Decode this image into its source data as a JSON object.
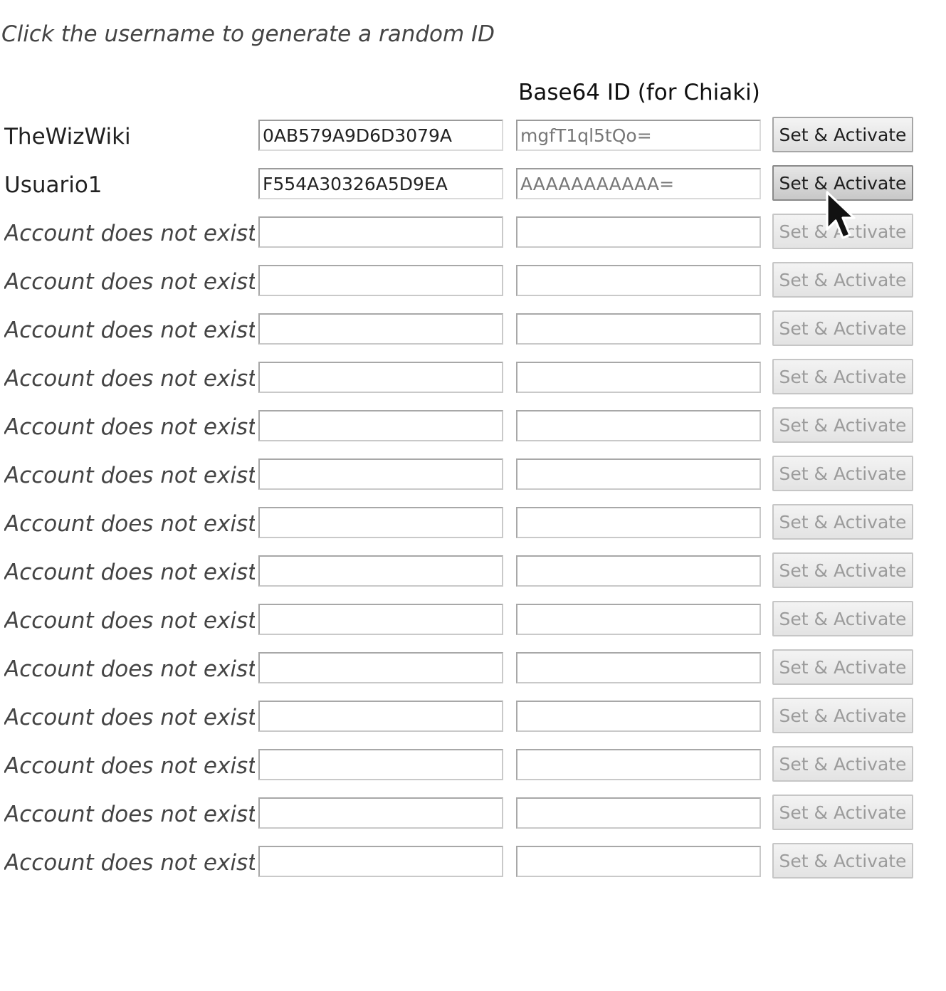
{
  "hint": "Click the username to generate a random ID",
  "header": {
    "base64_column": "Base64 ID (for Chiaki)"
  },
  "accounts": [
    {
      "username": "TheWizWiki",
      "hex_id": "0AB579A9D6D3079A",
      "base64_id": "mgfT1ql5tQo=",
      "button": "Set & Activate"
    },
    {
      "username": "Usuario1",
      "hex_id": "F554A30326A5D9EA",
      "base64_id": "AAAAAAAAAAA=",
      "button": "Set & Activate"
    },
    {
      "username": "Account does not exist",
      "hex_id": "",
      "base64_id": "",
      "button": "Set & Activate"
    },
    {
      "username": "Account does not exist",
      "hex_id": "",
      "base64_id": "",
      "button": "Set & Activate"
    },
    {
      "username": "Account does not exist",
      "hex_id": "",
      "base64_id": "",
      "button": "Set & Activate"
    },
    {
      "username": "Account does not exist",
      "hex_id": "",
      "base64_id": "",
      "button": "Set & Activate"
    },
    {
      "username": "Account does not exist",
      "hex_id": "",
      "base64_id": "",
      "button": "Set & Activate"
    },
    {
      "username": "Account does not exist",
      "hex_id": "",
      "base64_id": "",
      "button": "Set & Activate"
    },
    {
      "username": "Account does not exist",
      "hex_id": "",
      "base64_id": "",
      "button": "Set & Activate"
    },
    {
      "username": "Account does not exist",
      "hex_id": "",
      "base64_id": "",
      "button": "Set & Activate"
    },
    {
      "username": "Account does not exist",
      "hex_id": "",
      "base64_id": "",
      "button": "Set & Activate"
    },
    {
      "username": "Account does not exist",
      "hex_id": "",
      "base64_id": "",
      "button": "Set & Activate"
    },
    {
      "username": "Account does not exist",
      "hex_id": "",
      "base64_id": "",
      "button": "Set & Activate"
    },
    {
      "username": "Account does not exist",
      "hex_id": "",
      "base64_id": "",
      "button": "Set & Activate"
    },
    {
      "username": "Account does not exist",
      "hex_id": "",
      "base64_id": "",
      "button": "Set & Activate"
    },
    {
      "username": "Account does not exist",
      "hex_id": "",
      "base64_id": "",
      "button": "Set & Activate"
    }
  ],
  "icons": {
    "cursor": "mouse-pointer-icon"
  }
}
